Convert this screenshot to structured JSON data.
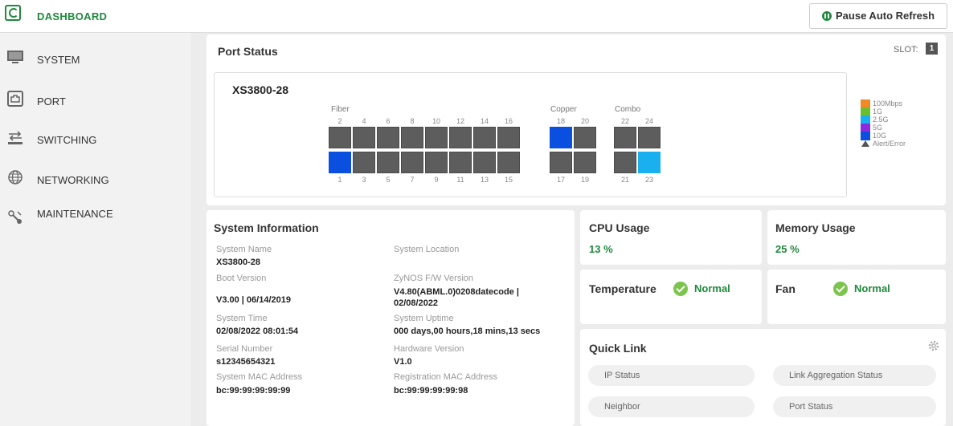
{
  "header": {
    "dashboard_label": "DASHBOARD",
    "pause_label": "Pause Auto Refresh"
  },
  "sidebar": {
    "items": [
      {
        "label": "SYSTEM",
        "icon": "monitor-icon"
      },
      {
        "label": "PORT",
        "icon": "port-icon"
      },
      {
        "label": "SWITCHING",
        "icon": "switching-icon"
      },
      {
        "label": "NETWORKING",
        "icon": "globe-icon"
      },
      {
        "label": "MAINTENANCE",
        "icon": "maintenance-icon"
      }
    ]
  },
  "port_status": {
    "title": "Port Status",
    "slot_label": "SLOT:",
    "slot_value": "1",
    "model": "XS3800-28",
    "groups": {
      "fiber": "Fiber",
      "copper": "Copper",
      "combo": "Combo"
    },
    "top_numbers": [
      "2",
      "4",
      "6",
      "8",
      "10",
      "12",
      "14",
      "16",
      "18",
      "20",
      "22",
      "24"
    ],
    "bottom_numbers": [
      "1",
      "3",
      "5",
      "7",
      "9",
      "11",
      "13",
      "15",
      "17",
      "19",
      "21",
      "23"
    ],
    "port_colors": {
      "default": "#5d5d5d",
      "10G": "#0a4fe0",
      "2.5G": "#1ab0f0"
    },
    "active_ports": {
      "1": "10G",
      "18": "10G",
      "23": "2.5G"
    }
  },
  "legend": [
    {
      "label": "100Mbps",
      "color": "#f08a24"
    },
    {
      "label": "1G",
      "color": "#6bbf2f"
    },
    {
      "label": "2.5G",
      "color": "#1ab0f0"
    },
    {
      "label": "5G",
      "color": "#8a2be2"
    },
    {
      "label": "10G",
      "color": "#0a4fe0"
    },
    {
      "label": "Alert/Error",
      "icon": "alert-icon"
    }
  ],
  "system_info": {
    "title": "System Information",
    "system_name_label": "System Name",
    "system_name": "XS3800-28",
    "system_location_label": "System Location",
    "boot_version_label": "Boot Version",
    "boot_version": "V3.00 | 06/14/2019",
    "fw_version_label": "ZyNOS F/W Version",
    "fw_version_line1": "V4.80(ABML.0)0208datecode |",
    "fw_version_line2": "02/08/2022",
    "system_time_label": "System Time",
    "system_time": "02/08/2022 08:01:54",
    "uptime_label": "System Uptime",
    "uptime": "000 days,00 hours,18 mins,13 secs",
    "serial_label": "Serial Number",
    "serial": "s12345654321",
    "hw_version_label": "Hardware Version",
    "hw_version": "V1.0",
    "mac_label": "System MAC Address",
    "mac": "bc:99:99:99:99:99",
    "reg_mac_label": "Registration MAC Address",
    "reg_mac": "bc:99:99:99:99:98"
  },
  "cpu": {
    "title": "CPU Usage",
    "value": "13 %"
  },
  "memory": {
    "title": "Memory Usage",
    "value": "25 %"
  },
  "temperature": {
    "title": "Temperature",
    "status": "Normal"
  },
  "fan": {
    "title": "Fan",
    "status": "Normal"
  },
  "quick_link": {
    "title": "Quick Link",
    "links": [
      "IP Status",
      "Link Aggregation Status",
      "Neighbor",
      "Port Status"
    ]
  }
}
